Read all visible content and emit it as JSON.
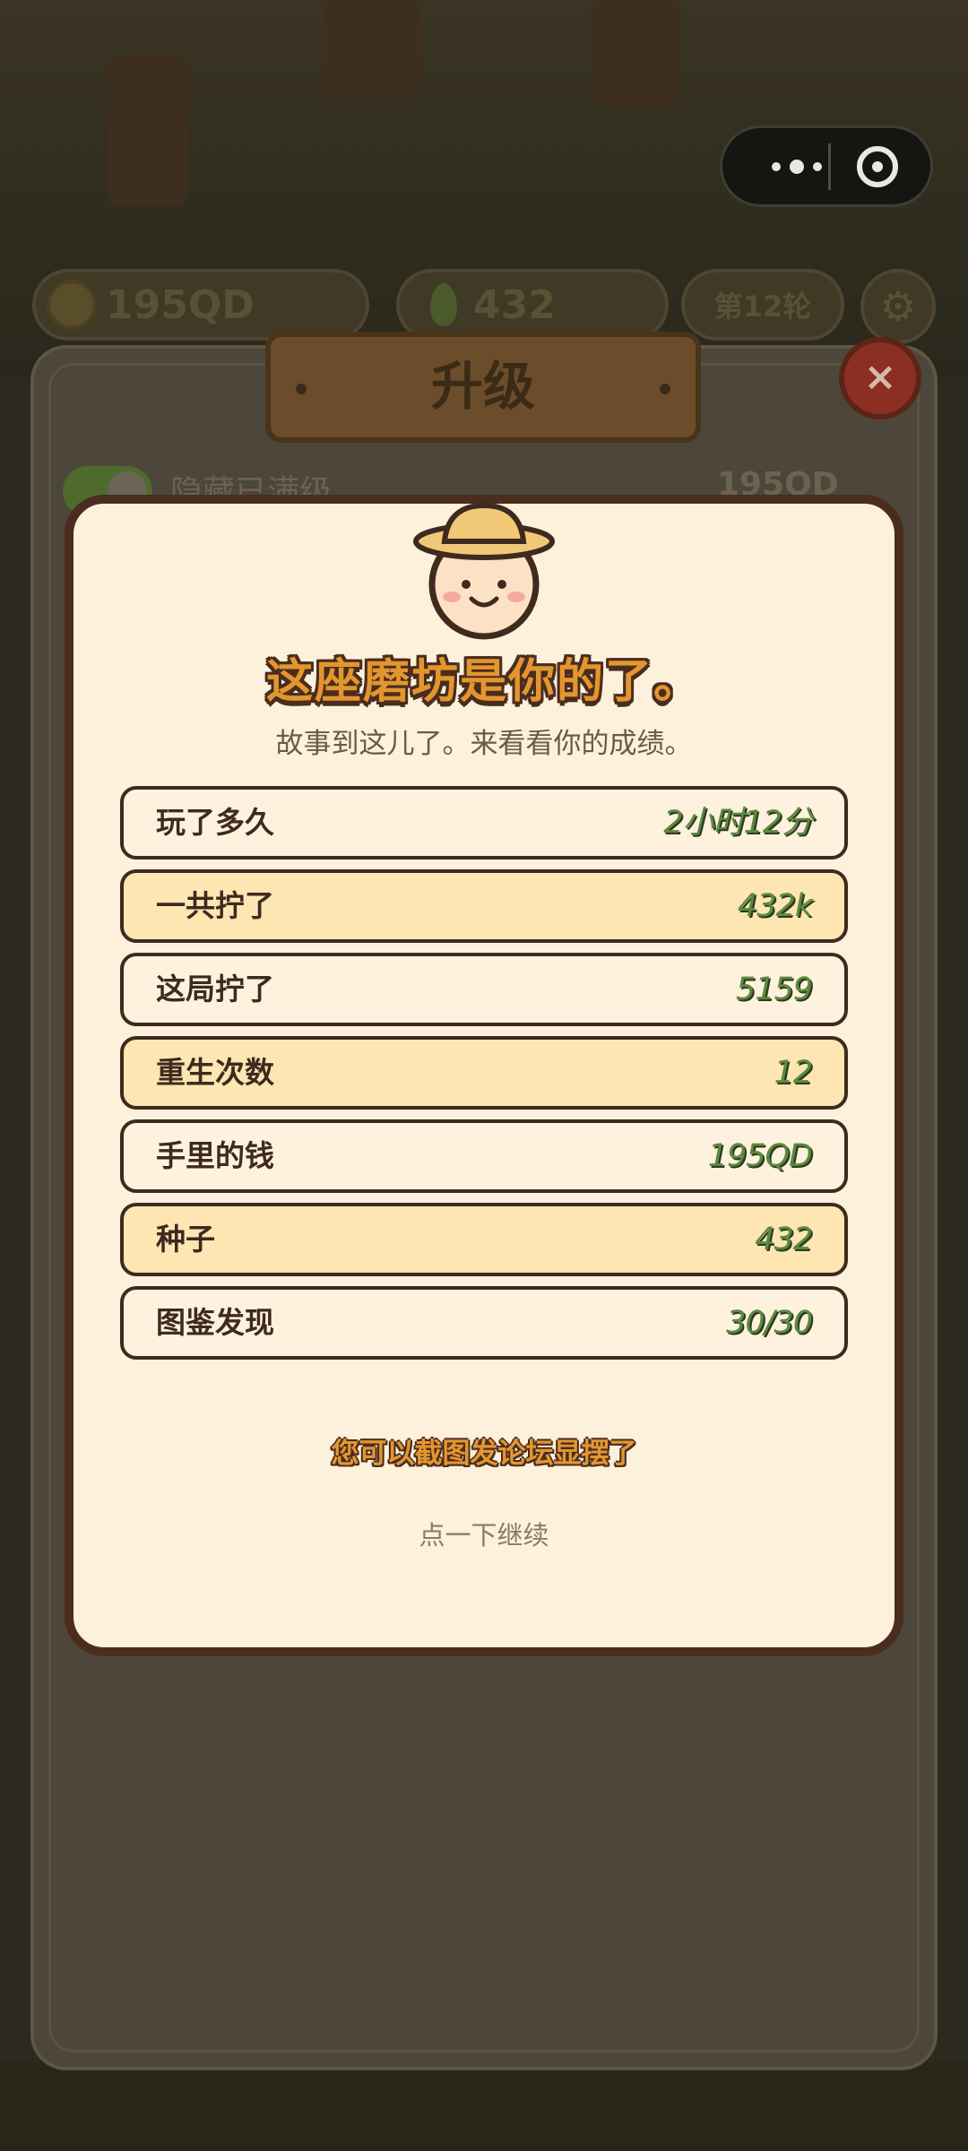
{
  "hud": {
    "money": "195QD",
    "seeds": "432",
    "round": "第12轮"
  },
  "background_panel": {
    "title": "升级",
    "close_symbol": "×",
    "hidden_label": "隐藏已满级",
    "money_preview": "195QD"
  },
  "modal": {
    "headline": "这座磨坊是你的了。",
    "subtitle": "故事到这儿了。来看看你的成绩。",
    "stats": [
      {
        "label": "玩了多久",
        "value": "2小时12分"
      },
      {
        "label": "一共拧了",
        "value": "432k"
      },
      {
        "label": "这局拧了",
        "value": "5159"
      },
      {
        "label": "重生次数",
        "value": "12"
      },
      {
        "label": "手里的钱",
        "value": "195QD"
      },
      {
        "label": "种子",
        "value": "432"
      },
      {
        "label": "图鉴发现",
        "value": "30/30"
      }
    ],
    "share_hint": "您可以截图发论坛显摆了",
    "continue_hint": "点一下继续"
  },
  "icons": {
    "capsule_menu": "more-dots-icon",
    "capsule_close": "target-circle-icon",
    "settings": "gear-icon",
    "character": "farmer-hat-face-icon"
  },
  "colors": {
    "modal_bg": "#fdf1dc",
    "highlight_row": "#fde6b2",
    "value_green": "#5b8a3c",
    "headline_orange": "#e4962e",
    "outline_brown": "#4a2d1f"
  }
}
